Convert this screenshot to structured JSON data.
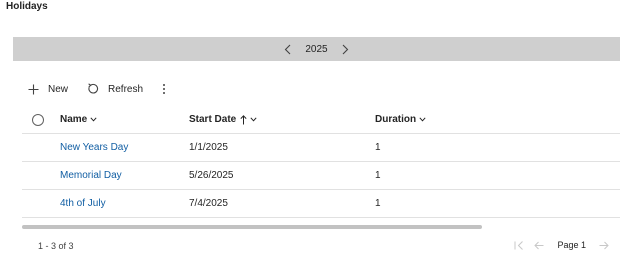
{
  "page": {
    "title": "Holidays"
  },
  "year_nav": {
    "year": "2025",
    "prev_icon": "chevron-left-icon",
    "next_icon": "chevron-right-icon"
  },
  "toolbar": {
    "new_label": "New",
    "refresh_label": "Refresh",
    "new_icon": "plus-icon",
    "refresh_icon": "refresh-icon",
    "more_icon": "more-vertical-icon"
  },
  "grid": {
    "columns": [
      {
        "label": "Name",
        "sort": "none"
      },
      {
        "label": "Start Date",
        "sort": "ascending"
      },
      {
        "label": "Duration",
        "sort": "none"
      }
    ],
    "rows": [
      {
        "name": "New Years Day",
        "start_date": "1/1/2025",
        "duration": "1"
      },
      {
        "name": "Memorial Day",
        "start_date": "5/26/2025",
        "duration": "1"
      },
      {
        "name": "4th of July",
        "start_date": "7/4/2025",
        "duration": "1"
      }
    ]
  },
  "footer": {
    "record_count": "1 - 3 of 3",
    "page_label": "Page 1"
  },
  "colors": {
    "year_bar": "#cfcfcf",
    "link": "#115ea3",
    "text": "#242424",
    "disabled": "#c8c8c8"
  }
}
